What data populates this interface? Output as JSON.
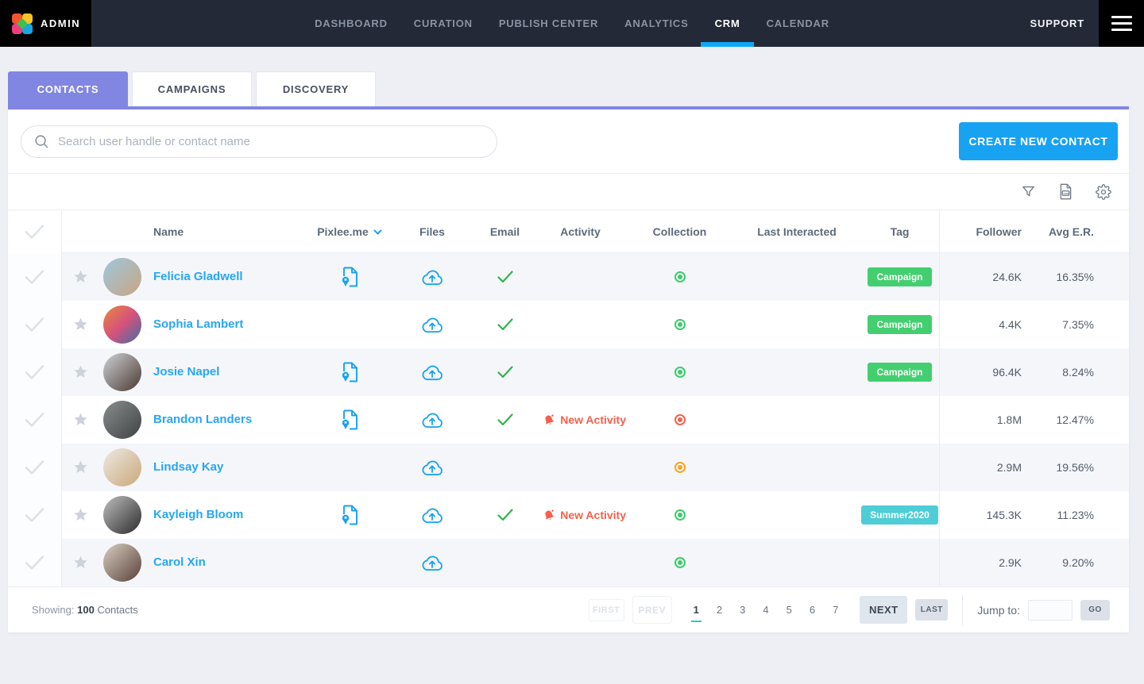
{
  "brand": {
    "name": "ADMIN"
  },
  "nav": {
    "items": [
      {
        "label": "DASHBOARD",
        "active": false
      },
      {
        "label": "CURATION",
        "active": false
      },
      {
        "label": "PUBLISH CENTER",
        "active": false
      },
      {
        "label": "ANALYTICS",
        "active": false
      },
      {
        "label": "CRM",
        "active": true
      },
      {
        "label": "CALENDAR",
        "active": false
      }
    ],
    "support": "SUPPORT"
  },
  "tabs": [
    {
      "label": "CONTACTS",
      "active": true
    },
    {
      "label": "CAMPAIGNS",
      "active": false
    },
    {
      "label": "DISCOVERY",
      "active": false
    }
  ],
  "search": {
    "placeholder": "Search user handle or contact name"
  },
  "actions": {
    "create_contact": "CREATE NEW CONTACT"
  },
  "toolbar": {
    "icons": [
      "filter-icon",
      "csv-export-icon",
      "settings-icon"
    ]
  },
  "colors": {
    "accent_blue": "#17a2f2",
    "tab_purple": "#8186e2",
    "link_blue": "#28a6f0",
    "success_green": "#2fb34c",
    "alert_red": "#f2614b",
    "collection": {
      "green": "#3ecb6c",
      "red": "#f4624a",
      "orange": "#f5a623"
    }
  },
  "table": {
    "columns": [
      "Name",
      "Pixlee.me",
      "Files",
      "Email",
      "Activity",
      "Collection",
      "Last Interacted",
      "Tag",
      "Follower",
      "Avg E.R."
    ],
    "sorted_column": "Pixlee.me",
    "rows": [
      {
        "name": "Felicia Gladwell",
        "pixlee_me": true,
        "files": true,
        "email": true,
        "activity": "",
        "collection": "green",
        "last_interacted": "",
        "tag": "Campaign",
        "tag_color": "#43cf70",
        "follower": "24.6K",
        "avg_er": "16.35%",
        "avatar": [
          "#9ec7dd",
          "#c9a583"
        ]
      },
      {
        "name": "Sophia Lambert",
        "pixlee_me": false,
        "files": true,
        "email": true,
        "activity": "",
        "collection": "green",
        "last_interacted": "",
        "tag": "Campaign",
        "tag_color": "#43cf70",
        "follower": "4.4K",
        "avg_er": "7.35%",
        "avatar": [
          "#e98a3c",
          "#d5527c",
          "#3a6ea8"
        ]
      },
      {
        "name": "Josie Napel",
        "pixlee_me": true,
        "files": true,
        "email": true,
        "activity": "",
        "collection": "green",
        "last_interacted": "",
        "tag": "Campaign",
        "tag_color": "#43cf70",
        "follower": "96.4K",
        "avg_er": "8.24%",
        "avatar": [
          "#cfd3d6",
          "#4a3830"
        ]
      },
      {
        "name": "Brandon Landers",
        "pixlee_me": true,
        "files": true,
        "email": true,
        "activity": "New Activity",
        "collection": "red",
        "last_interacted": "",
        "tag": "",
        "tag_color": "",
        "follower": "1.8M",
        "avg_er": "12.47%",
        "avatar": [
          "#8a8d8c",
          "#3f4345"
        ]
      },
      {
        "name": "Lindsay Kay",
        "pixlee_me": false,
        "files": true,
        "email": false,
        "activity": "",
        "collection": "orange",
        "last_interacted": "",
        "tag": "",
        "tag_color": "",
        "follower": "2.9M",
        "avg_er": "19.56%",
        "avatar": [
          "#ece9e4",
          "#caa878"
        ]
      },
      {
        "name": "Kayleigh Bloom",
        "pixlee_me": true,
        "files": true,
        "email": true,
        "activity": "New Activity",
        "collection": "green",
        "last_interacted": "",
        "tag": "Summer2020",
        "tag_color": "#4ecdd6",
        "follower": "145.3K",
        "avg_er": "11.23%",
        "avatar": [
          "#bfbfbf",
          "#2b2b2b"
        ]
      },
      {
        "name": "Carol Xin",
        "pixlee_me": false,
        "files": true,
        "email": false,
        "activity": "",
        "collection": "green",
        "last_interacted": "",
        "tag": "",
        "tag_color": "",
        "follower": "2.9K",
        "avg_er": "9.20%",
        "avatar": [
          "#d8cec2",
          "#584139"
        ]
      }
    ]
  },
  "pagination": {
    "showing_label": "Showing:",
    "count": "100",
    "unit": "Contacts",
    "first": "FIRST",
    "prev": "PREV",
    "pages": [
      "1",
      "2",
      "3",
      "4",
      "5",
      "6",
      "7"
    ],
    "current_page": "1",
    "next": "NEXT",
    "last": "LAST",
    "jump_label": "Jump to:",
    "go": "GO"
  }
}
